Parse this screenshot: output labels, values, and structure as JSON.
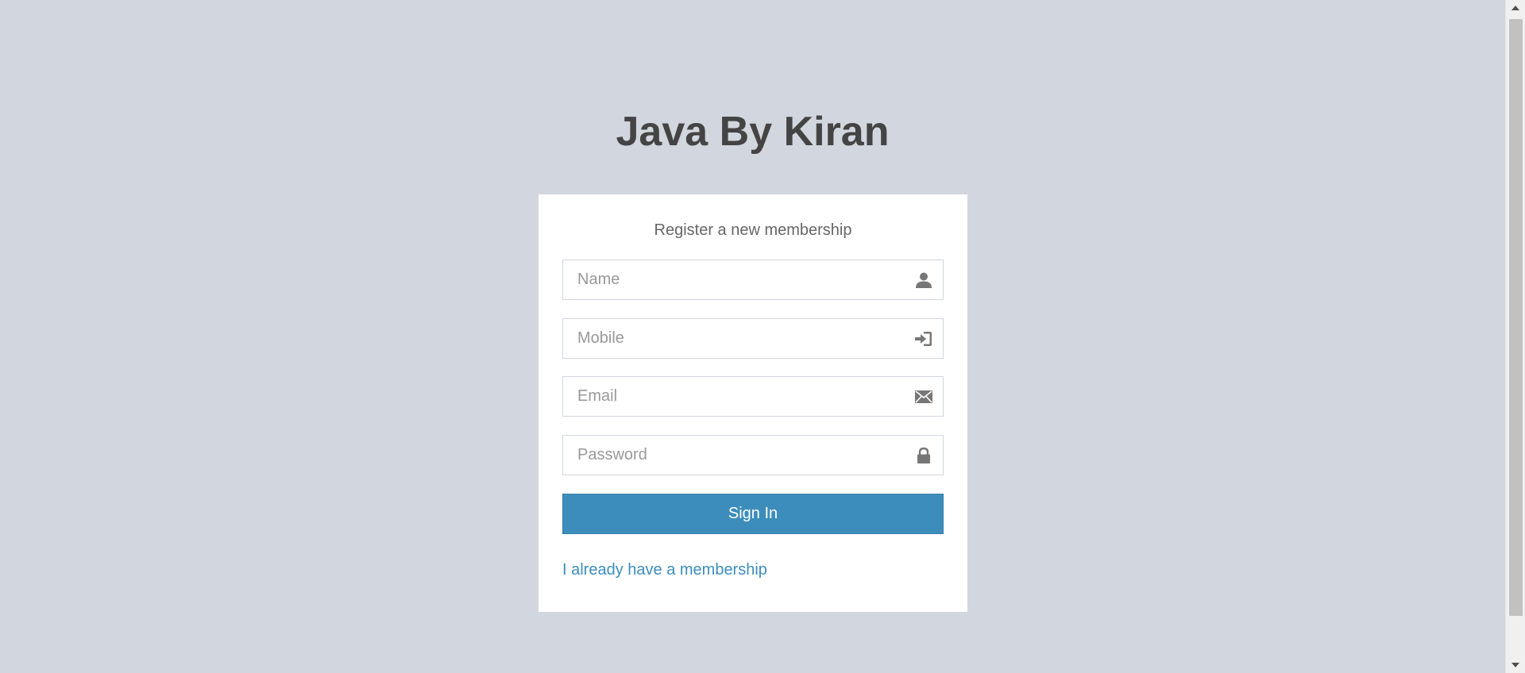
{
  "logo": {
    "title": "Java By Kiran"
  },
  "form": {
    "message": "Register a new membership",
    "name_placeholder": "Name",
    "mobile_placeholder": "Mobile",
    "email_placeholder": "Email",
    "password_placeholder": "Password",
    "submit_label": "Sign In",
    "login_link": "I already have a membership"
  },
  "icons": {
    "name": "user-icon",
    "mobile": "log-in-icon",
    "email": "envelope-icon",
    "password": "lock-icon"
  },
  "colors": {
    "background": "#d2d6de",
    "button": "#3c8dbc",
    "link": "#3c8dbc",
    "title": "#444444"
  }
}
